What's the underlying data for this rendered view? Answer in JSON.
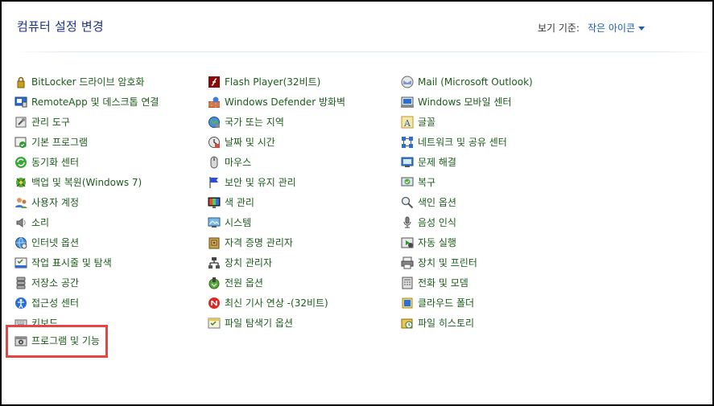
{
  "header": {
    "title": "컴퓨터 설정 변경",
    "view_by_label": "보기 기준:",
    "view_by_value": "작은 아이콘"
  },
  "columns": [
    [
      {
        "label": "BitLocker 드라이브 암호화",
        "icon": "bitlocker-icon"
      },
      {
        "label": "RemoteApp 및 데스크톱 연결",
        "icon": "remoteapp-icon"
      },
      {
        "label": "관리 도구",
        "icon": "admin-tools-icon"
      },
      {
        "label": "기본 프로그램",
        "icon": "default-programs-icon"
      },
      {
        "label": "동기화 센터",
        "icon": "sync-center-icon"
      },
      {
        "label": "백업 및 복원(Windows 7)",
        "icon": "backup-restore-icon"
      },
      {
        "label": "사용자 계정",
        "icon": "user-accounts-icon"
      },
      {
        "label": "소리",
        "icon": "sound-icon"
      },
      {
        "label": "인터넷 옵션",
        "icon": "internet-options-icon"
      },
      {
        "label": "작업 표시줄 및 탐색",
        "icon": "taskbar-icon"
      },
      {
        "label": "저장소 공간",
        "icon": "storage-spaces-icon"
      },
      {
        "label": "접근성 센터",
        "icon": "ease-of-access-icon"
      },
      {
        "label": "키보드",
        "icon": "keyboard-icon"
      }
    ],
    [
      {
        "label": "Flash Player(32비트)",
        "icon": "flash-player-icon"
      },
      {
        "label": "Windows Defender 방화벽",
        "icon": "firewall-icon"
      },
      {
        "label": "국가 또는 지역",
        "icon": "region-icon"
      },
      {
        "label": "날짜 및 시간",
        "icon": "date-time-icon"
      },
      {
        "label": "마우스",
        "icon": "mouse-icon"
      },
      {
        "label": "보안 및 유지 관리",
        "icon": "security-maintenance-icon"
      },
      {
        "label": "색 관리",
        "icon": "color-management-icon"
      },
      {
        "label": "시스템",
        "icon": "system-icon"
      },
      {
        "label": "자격 증명 관리자",
        "icon": "credential-manager-icon"
      },
      {
        "label": "장치 관리자",
        "icon": "device-manager-icon"
      },
      {
        "label": "전원 옵션",
        "icon": "power-options-icon"
      },
      {
        "label": "최신 기사 연상 -(32비트)",
        "icon": "news-icon"
      },
      {
        "label": "파일 탐색기 옵션",
        "icon": "file-explorer-options-icon"
      }
    ],
    [
      {
        "label": "Mail (Microsoft Outlook)",
        "icon": "mail-icon"
      },
      {
        "label": "Windows 모바일 센터",
        "icon": "mobility-center-icon"
      },
      {
        "label": "글꼴",
        "icon": "fonts-icon"
      },
      {
        "label": "네트워크 및 공유 센터",
        "icon": "network-sharing-icon"
      },
      {
        "label": "문제 해결",
        "icon": "troubleshooting-icon"
      },
      {
        "label": "복구",
        "icon": "recovery-icon"
      },
      {
        "label": "색인 옵션",
        "icon": "indexing-options-icon"
      },
      {
        "label": "음성 인식",
        "icon": "speech-recognition-icon"
      },
      {
        "label": "자동 실행",
        "icon": "autoplay-icon"
      },
      {
        "label": "장치 및 프린터",
        "icon": "devices-printers-icon"
      },
      {
        "label": "전화 및 모뎀",
        "icon": "phone-modem-icon"
      },
      {
        "label": "클라우드 폴더",
        "icon": "cloud-folder-icon"
      },
      {
        "label": "파일 히스토리",
        "icon": "file-history-icon"
      }
    ]
  ],
  "highlighted_item": {
    "label": "프로그램 및 기능",
    "icon": "programs-features-icon"
  },
  "colors": {
    "title": "#1e3287",
    "link": "#1a5c1a",
    "dropdown": "#1a5fb4",
    "highlight_border": "#e64545"
  }
}
